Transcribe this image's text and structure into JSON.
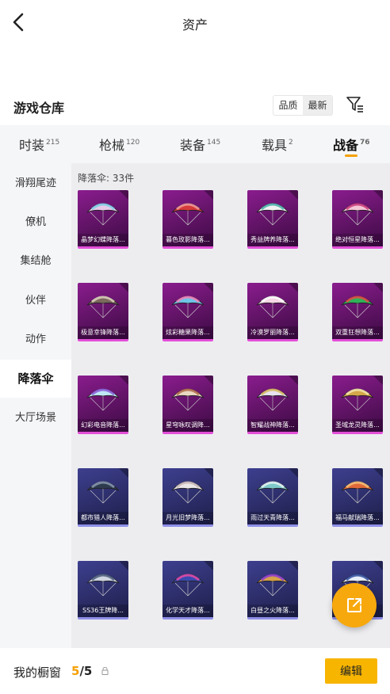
{
  "header": {
    "title": "资产",
    "back_icon": "chevron-left-icon"
  },
  "section": {
    "title": "游戏仓库",
    "sort_options": [
      "品质",
      "最新"
    ],
    "filter_icon": "filter-icon"
  },
  "tabs": [
    {
      "label": "时装",
      "count": "215"
    },
    {
      "label": "枪械",
      "count": "120"
    },
    {
      "label": "装备",
      "count": "145"
    },
    {
      "label": "载具",
      "count": "2"
    },
    {
      "label": "战备",
      "count": "76"
    }
  ],
  "sidebar": [
    {
      "label": "滑翔尾迹"
    },
    {
      "label": "僚机"
    },
    {
      "label": "集结舱"
    },
    {
      "label": "伙伴"
    },
    {
      "label": "动作"
    },
    {
      "label": "降落伞"
    },
    {
      "label": "大厅场景"
    }
  ],
  "content": {
    "count_label": "降落伞: 33件",
    "items": [
      {
        "name": "晶梦幻蝶降落...",
        "rarity": "purple",
        "colors": [
          "#e8c9e8",
          "#7fd0e8"
        ]
      },
      {
        "name": "暮色玫影降落...",
        "rarity": "purple",
        "colors": [
          "#d63a3a",
          "#f0a0a0"
        ]
      },
      {
        "name": "秀益牌养降落...",
        "rarity": "purple",
        "colors": [
          "#f2f2f2",
          "#49b0a8"
        ]
      },
      {
        "name": "绝对恒星降落...",
        "rarity": "purple",
        "colors": [
          "#f4c7d6",
          "#c93a7d"
        ]
      },
      {
        "name": "极意幸锋降落...",
        "rarity": "purple",
        "colors": [
          "#7c6a5e",
          "#e0d2c0"
        ]
      },
      {
        "name": "炫彩糖果降落...",
        "rarity": "purple",
        "colors": [
          "#6fc5e8",
          "#f57db6"
        ]
      },
      {
        "name": "冷漠罗丽降落...",
        "rarity": "purple",
        "colors": [
          "#f7d6e6",
          "#ffffff"
        ]
      },
      {
        "name": "双重狂想降落...",
        "rarity": "purple",
        "colors": [
          "#2fb35a",
          "#e84646"
        ]
      },
      {
        "name": "幻彩电音降落...",
        "rarity": "purple",
        "colors": [
          "#bfe8f4",
          "#8a5ad8"
        ]
      },
      {
        "name": "星穹咏叹调降...",
        "rarity": "purple",
        "colors": [
          "#ead9c2",
          "#b06a4a"
        ]
      },
      {
        "name": "智耀战神降落...",
        "rarity": "purple",
        "colors": [
          "#e8e2f0",
          "#d6b85e"
        ]
      },
      {
        "name": "圣域龙灵降落...",
        "rarity": "purple",
        "colors": [
          "#d4a84a",
          "#f5e6b0"
        ]
      },
      {
        "name": "都市猎人降落...",
        "rarity": "blue",
        "colors": [
          "#2e3a4e",
          "#8a9ab0"
        ]
      },
      {
        "name": "月光旧梦降落...",
        "rarity": "blue",
        "colors": [
          "#ece8e8",
          "#c9b7b7"
        ]
      },
      {
        "name": "雨过天青降落...",
        "rarity": "blue",
        "colors": [
          "#7fc9c9",
          "#e8f4f4"
        ]
      },
      {
        "name": "福马献瑞降落...",
        "rarity": "blue",
        "colors": [
          "#e06a3a",
          "#f5c27a"
        ]
      },
      {
        "name": "SS36王牌降...",
        "rarity": "blue",
        "colors": [
          "#cfd4e0",
          "#4a5a7a"
        ]
      },
      {
        "name": "化学天才降落...",
        "rarity": "blue",
        "colors": [
          "#3a4ab0",
          "#e84aa8"
        ]
      },
      {
        "name": "白昼之火降落...",
        "rarity": "blue",
        "colors": [
          "#d6a24a",
          "#8a3ad8"
        ]
      },
      {
        "name": "",
        "rarity": "blue",
        "colors": [
          "#e8eef8",
          "#2e4a9a"
        ]
      }
    ]
  },
  "fab": {
    "icon": "external-link-icon"
  },
  "bottom": {
    "showcase_label": "我的橱窗",
    "showcase_used": "5",
    "showcase_total": "/5",
    "edit_label": "编辑"
  }
}
